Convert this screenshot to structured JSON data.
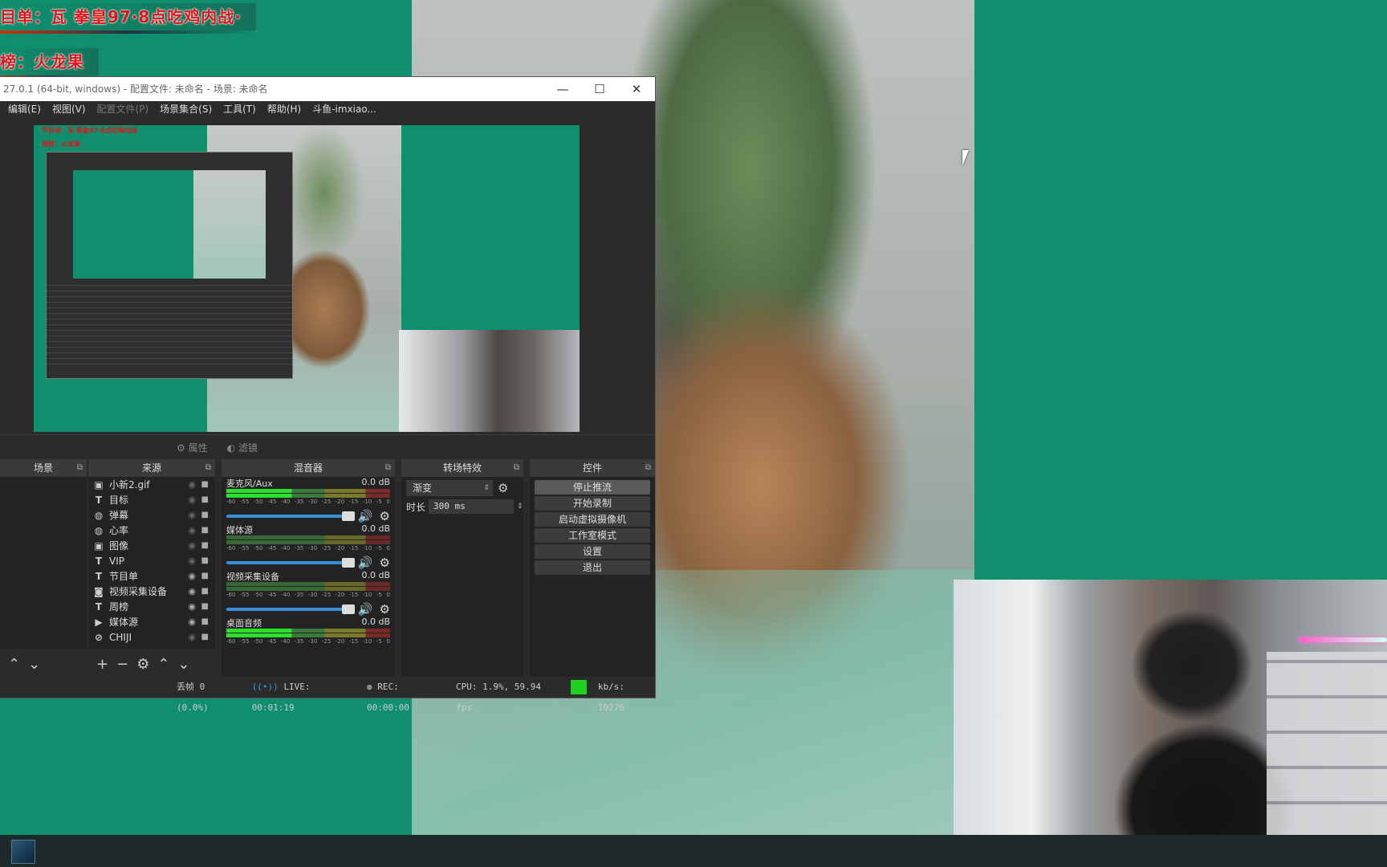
{
  "overlays": {
    "program_line": "目单：瓦 拳皇97·8点吃鸡内战·",
    "ranking_line": "榜：火龙果"
  },
  "obs": {
    "title": "27.0.1 (64-bit, windows) - 配置文件: 未命名 - 场景: 未命名",
    "window_controls": {
      "minimize": "—",
      "maximize": "☐",
      "close": "✕"
    },
    "menu": [
      "编辑(E)",
      "视图(V)",
      "配置文件(P)",
      "场景集合(S)",
      "工具(T)",
      "帮助(H)",
      "斗鱼-imxiao..."
    ],
    "preview_captions": [
      "节目单：瓦 拳皇97·8点吃鸡内战",
      "周榜：火龙果"
    ],
    "toolbar": {
      "properties": "属性",
      "filters": "滤镜"
    },
    "docks": {
      "scenes": {
        "title": "场景"
      },
      "sources": {
        "title": "来源",
        "items": [
          {
            "icon": "image-icon",
            "label": "小新2.gif",
            "visible": false
          },
          {
            "icon": "text-icon",
            "label": "目标",
            "visible": false
          },
          {
            "icon": "browser-icon",
            "label": "弹幕",
            "visible": false
          },
          {
            "icon": "browser-icon",
            "label": "心率",
            "visible": false
          },
          {
            "icon": "image-icon",
            "label": "图像",
            "visible": false
          },
          {
            "icon": "text-icon",
            "label": "VIP",
            "visible": false
          },
          {
            "icon": "text-icon",
            "label": "节目单",
            "visible": true
          },
          {
            "icon": "camera-icon",
            "label": "视频采集设备",
            "visible": true
          },
          {
            "icon": "text-icon",
            "label": "周榜",
            "visible": true
          },
          {
            "icon": "media-icon",
            "label": "媒体源",
            "visible": true
          },
          {
            "icon": "group-icon",
            "label": "CHIJI",
            "visible": false
          }
        ]
      },
      "mixer": {
        "title": "混音器",
        "tracks": [
          {
            "name": "麦克风/Aux",
            "db": "0.0 dB"
          },
          {
            "name": "媒体源",
            "db": "0.0 dB"
          },
          {
            "name": "视频采集设备",
            "db": "0.0 dB"
          },
          {
            "name": "桌面音频",
            "db": "0.0 dB"
          }
        ],
        "scale": [
          "-60",
          "-55",
          "-50",
          "-45",
          "-40",
          "-35",
          "-30",
          "-25",
          "-20",
          "-15",
          "-10",
          "-5",
          "0"
        ]
      },
      "transitions": {
        "title": "转场特效",
        "selected": "渐变",
        "duration_label": "时长",
        "duration_value": "300 ms"
      },
      "controls": {
        "title": "控件",
        "buttons": [
          "停止推流",
          "开始录制",
          "启动虚拟摄像机",
          "工作室模式",
          "设置",
          "退出"
        ]
      }
    },
    "status": {
      "dropped": "丢帧 0 (0.0%)",
      "live": "LIVE: 00:01:19",
      "rec": "REC: 00:00:00",
      "cpu": "CPU: 1.9%, 59.94 fps",
      "bitrate": "kb/s: 10276"
    }
  },
  "colors": {
    "desktop": "#0f8f6e",
    "caption_red": "#e0141a",
    "status_green": "#1fd21f"
  }
}
